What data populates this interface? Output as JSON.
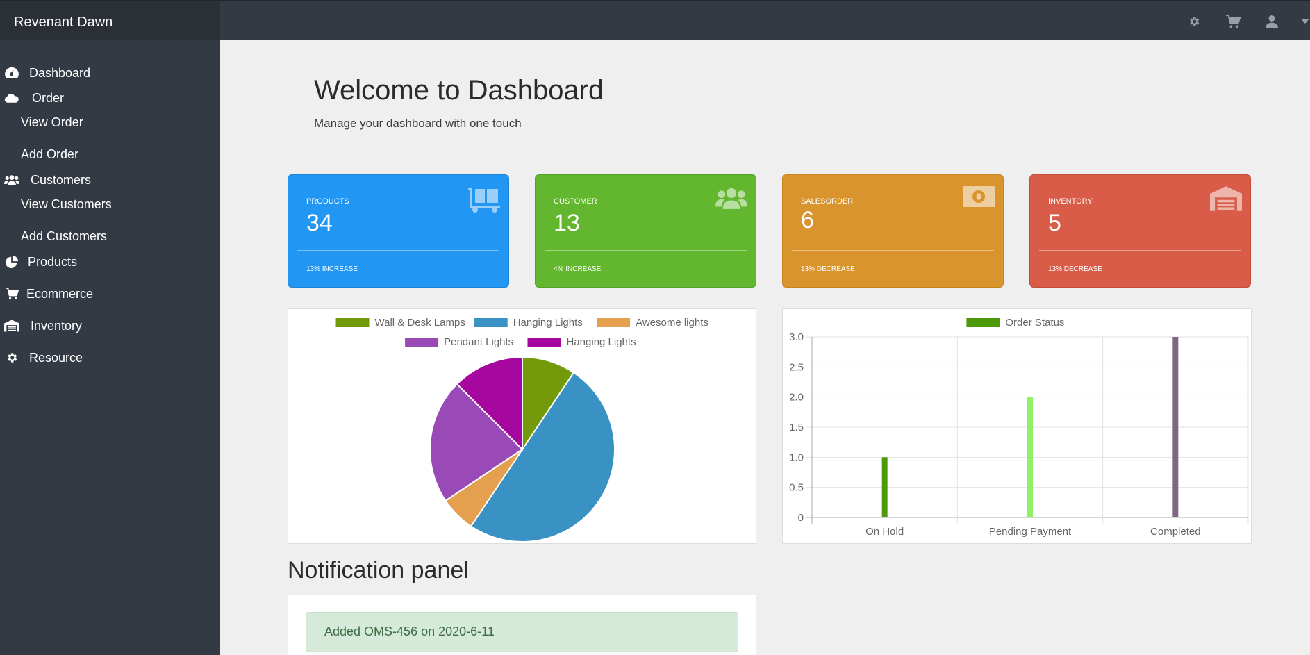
{
  "app": {
    "brand": "Revenant Dawn"
  },
  "topbar": {
    "icons": [
      "gear-icon",
      "cart-icon",
      "user-icon",
      "caret-down-icon"
    ]
  },
  "sidebar": {
    "items": [
      {
        "label": "Dashboard",
        "icon": "dashboard-icon"
      },
      {
        "label": "Order",
        "icon": "cloud-icon"
      },
      {
        "label": "View Order"
      },
      {
        "label": "Add Order"
      },
      {
        "label": "Customers",
        "icon": "users-icon"
      },
      {
        "label": "View Customers"
      },
      {
        "label": "Add Customers"
      },
      {
        "label": "Products",
        "icon": "pie-icon"
      },
      {
        "label": "Ecommerce",
        "icon": "cart-icon"
      },
      {
        "label": "Inventory",
        "icon": "warehouse-icon"
      },
      {
        "label": "Resource",
        "icon": "gear-icon"
      }
    ]
  },
  "main": {
    "title": "Welcome to Dashboard",
    "subtitle": "Manage your dashboard with one touch",
    "cards": [
      {
        "label": "PRODUCTS",
        "value": "34",
        "foot": "13% INCREASE",
        "color": "#2196f3",
        "icon": "dolly-icon"
      },
      {
        "label": "CUSTOMER",
        "value": "13",
        "foot": "4% INCREASE",
        "color": "#63b72e",
        "icon": "users-icon"
      },
      {
        "label": "SALESORDER",
        "value": "6",
        "foot": "13% DECREASE",
        "color": "#d9942d",
        "icon": "money-icon"
      },
      {
        "label": "INVENTORY",
        "value": "5",
        "foot": "13% DECREASE",
        "color": "#d95c48",
        "icon": "warehouse-icon"
      }
    ],
    "notification": {
      "title": "Notification panel",
      "alert": "Added OMS-456 on 2020-6-11"
    }
  },
  "chart_data": [
    {
      "type": "pie",
      "series": [
        {
          "name": "Wall & Desk Lamps",
          "value": 3,
          "color": "#729a0a"
        },
        {
          "name": "Hanging Lights",
          "value": 16,
          "color": "#3a92c4"
        },
        {
          "name": "Awesome lights",
          "value": 2,
          "color": "#e4a04f"
        },
        {
          "name": "Pendant Lights",
          "value": 7,
          "color": "#9a4ab6"
        },
        {
          "name": "Hanging Lights",
          "value": 4,
          "color": "#a6079f"
        }
      ],
      "legend_position": "top"
    },
    {
      "type": "bar",
      "categories": [
        "On Hold",
        "Pending Payment",
        "Completed"
      ],
      "series": [
        {
          "name": "Order Status",
          "values": [
            1,
            2,
            3
          ],
          "colors": [
            "#4c9a09",
            "#90f068",
            "#7e6781"
          ]
        }
      ],
      "ylim": [
        0,
        3
      ],
      "yticks": [
        "0",
        "0.5",
        "1.0",
        "1.5",
        "2.0",
        "2.5",
        "3.0"
      ],
      "grid": true,
      "legend_position": "top"
    }
  ]
}
